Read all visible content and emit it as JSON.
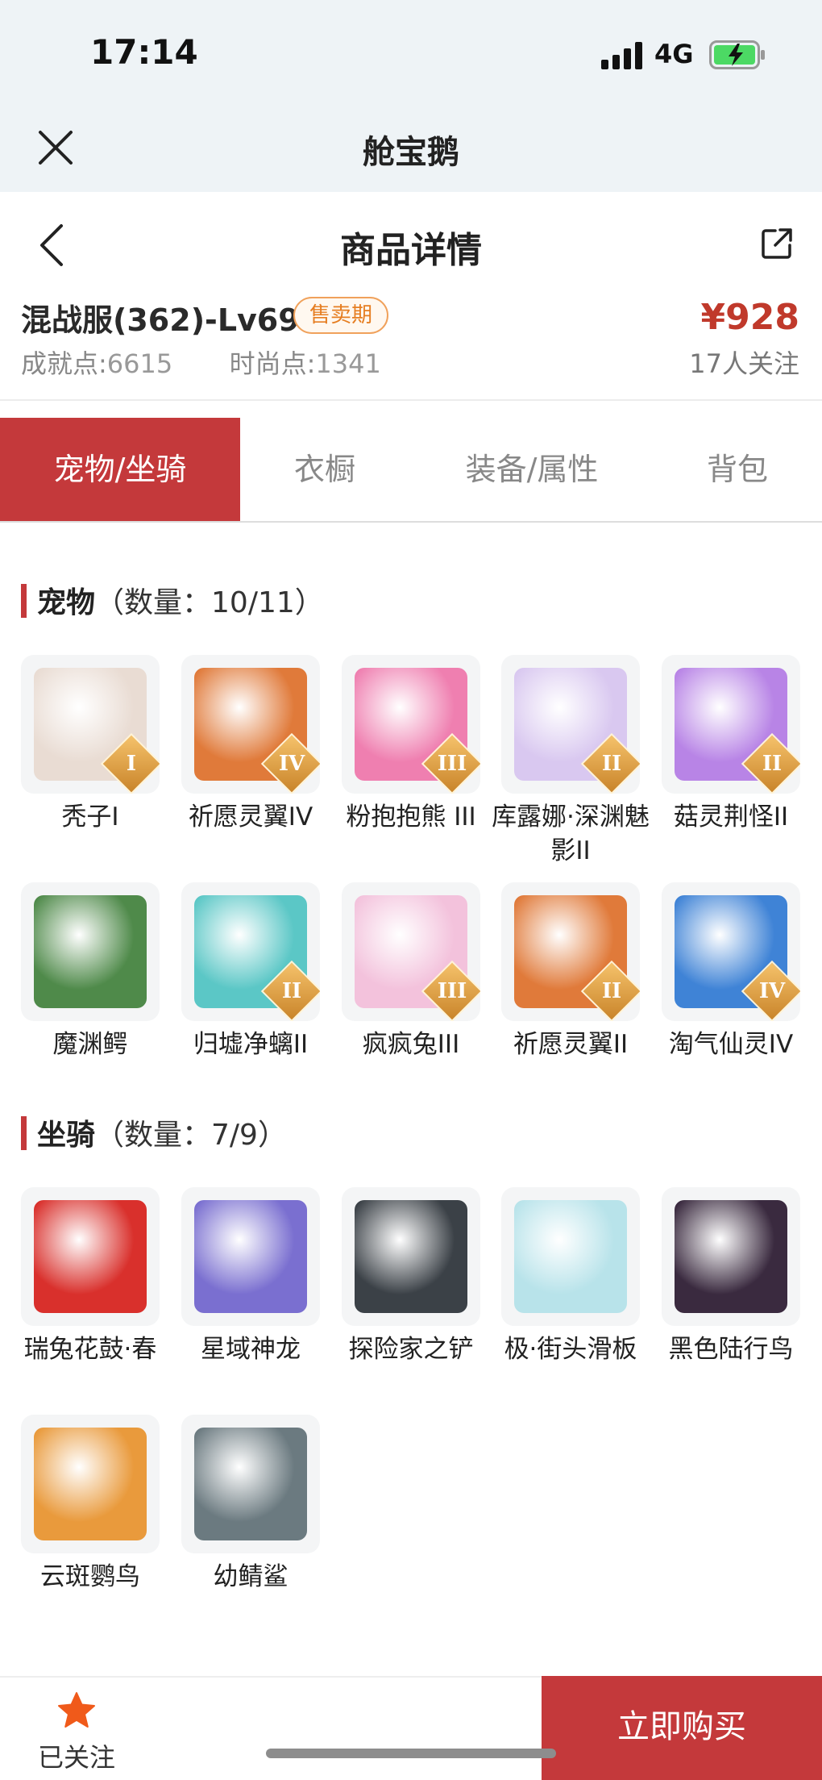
{
  "status_bar": {
    "time": "17:14",
    "network": "4G"
  },
  "app_bar": {
    "title": "舱宝鹅"
  },
  "header": {
    "title": "商品详情"
  },
  "product": {
    "name": "混战服(362)-Lv69",
    "badge": "售卖期",
    "achievement_label": "成就点:",
    "achievement_value": "6615",
    "fashion_label": "时尚点:",
    "fashion_value": "1341",
    "price": "¥928",
    "followers": "17人关注"
  },
  "tabs": [
    {
      "label": "宠物/坐骑",
      "active": true
    },
    {
      "label": "衣橱",
      "active": false
    },
    {
      "label": "装备/属性",
      "active": false
    },
    {
      "label": "背包",
      "active": false
    }
  ],
  "pets": {
    "title": "宠物",
    "count": "（数量：10/11）",
    "items": [
      {
        "label": "秃子I",
        "rank": "I",
        "color": "#e9dcd3"
      },
      {
        "label": "祈愿灵翼IV",
        "rank": "IV",
        "color": "#e07a3a"
      },
      {
        "label": "粉抱抱熊 III",
        "rank": "III",
        "color": "#ef7fb0"
      },
      {
        "label": "库露娜·深渊魅影II",
        "rank": "II",
        "color": "#d9c8f0"
      },
      {
        "label": "菇灵荆怪II",
        "rank": "II",
        "color": "#b884e6"
      },
      {
        "label": "魔渊鳄",
        "rank": "",
        "color": "#4f8a4a"
      },
      {
        "label": "归墟净螭II",
        "rank": "II",
        "color": "#5bc7c6"
      },
      {
        "label": "疯疯兔III",
        "rank": "III",
        "color": "#f3c2dc"
      },
      {
        "label": "祈愿灵翼II",
        "rank": "II",
        "color": "#e07a3a"
      },
      {
        "label": "淘气仙灵IV",
        "rank": "IV",
        "color": "#3f83d6"
      }
    ]
  },
  "mounts": {
    "title": "坐骑",
    "count": "（数量：7/9）",
    "items": [
      {
        "label": "瑞兔花鼓·春",
        "color": "#d9302c"
      },
      {
        "label": "星域神龙",
        "color": "#7a6fd0"
      },
      {
        "label": "探险家之铲",
        "color": "#3b4147"
      },
      {
        "label": "极·街头滑板",
        "color": "#b8e3ea"
      },
      {
        "label": "黑色陆行鸟",
        "color": "#3a2a3f"
      },
      {
        "label": "云斑鹦鸟",
        "color": "#e99a3c"
      },
      {
        "label": "幼鲭鲨",
        "color": "#6b7a80"
      }
    ]
  },
  "bottom": {
    "follow_label": "已关注",
    "buy_label": "立即购买"
  },
  "colors": {
    "accent": "#c4393b",
    "price": "#c0392b",
    "badge": "#e67e22"
  }
}
